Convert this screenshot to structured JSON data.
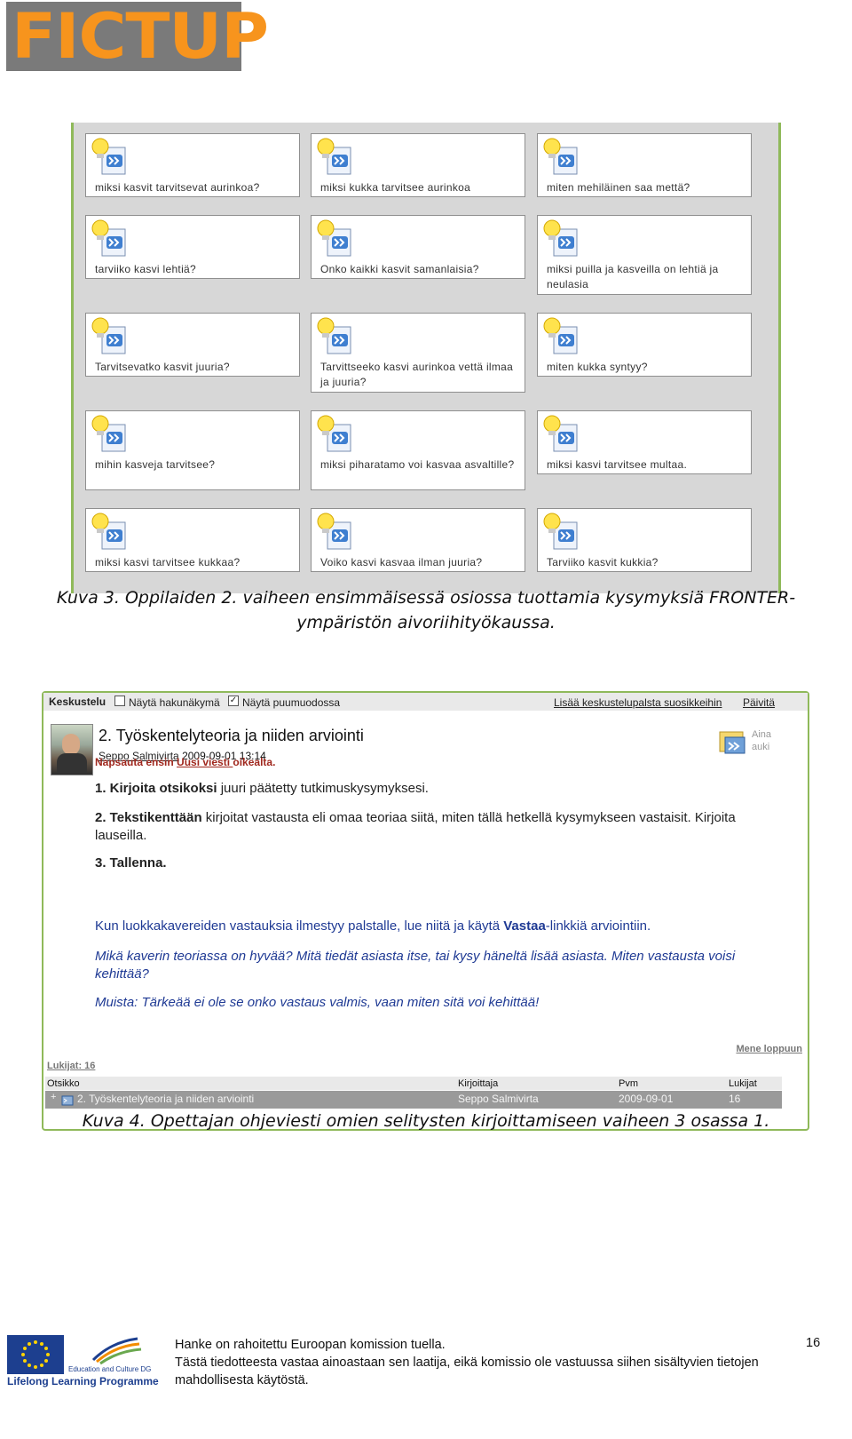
{
  "logo": {
    "text": "FICTUP",
    "bg": "#7a7a7a",
    "fg": "#f7941d"
  },
  "figure1": {
    "questions": [
      "miksi kasvit tarvitsevat aurinkoa?",
      "miksi kukka tarvitsee aurinkoa",
      "miten mehiläinen saa mettä?",
      "tarviiko kasvi lehtiä?",
      "Onko kaikki kasvit samanlaisia?",
      "miksi puilla ja kasveilla on lehtiä ja neulasia",
      "Tarvitsevatko kasvit juuria?",
      "Tarvittseeko kasvi aurinkoa vettä ilmaa ja juuria?",
      "miten kukka syntyy?",
      "mihin kasveja tarvitsee?",
      "miksi piharatamo voi kasvaa asvaltille?",
      "miksi kasvi tarvitsee multaa.",
      "miksi kasvi tarvitsee kukkaa?",
      "Voiko kasvi kasvaa ilman juuria?",
      "Tarviiko kasvit kukkia?"
    ],
    "caption_line1": "Kuva 3. Oppilaiden 2. vaiheen ensimmäisessä osiossa tuottamia kysymyksiä FRONTER-",
    "caption_line2": "ympäristön aivoriihityökaussa."
  },
  "figure2": {
    "topbar": {
      "title": "Keskustelu",
      "opt1": "Näytä hakunäkymä",
      "opt2": "Näytä puumuodossa",
      "link1": "Lisää keskustelupalsta suosikkeihin",
      "link2": "Päivitä"
    },
    "message": {
      "title": "2. Työskentelyteoria ja niiden arviointi",
      "author": "Seppo Salmivirta",
      "date": "2009-09-01 13:14",
      "aina": "Aina auki"
    },
    "instr_red_a": "Napsauta ensin ",
    "instr_red_link": "Uusi viesti ",
    "instr_red_b": "oikealta.",
    "step1_bold": "1. Kirjoita otsikoksi",
    "step1_rest": " juuri päätetty tutkimuskysymyksesi.",
    "step2_bold": "2. Tekstikenttään",
    "step2_rest": " kirjoitat vastausta eli omaa teoriaa siitä, miten tällä hetkellä kysymykseen vastaisit. Kirjoita lauseilla.",
    "step3": "3. Tallenna.",
    "blue1_a": "Kun luokkakavereiden vastauksia ilmestyy palstalle, lue niitä ja käytä ",
    "blue1_b": "Vastaa",
    "blue1_c": "-linkkiä arviointiin.",
    "blue2": "Mikä kaverin teoriassa on hyvää? Mitä tiedät asiasta itse, tai kysy häneltä lisää asiasta. Miten vastausta voisi kehittää?",
    "blue3": "Muista: Tärkeää ei ole se onko vastaus valmis, vaan miten sitä voi kehittää!",
    "mene": "Mene loppuun",
    "lukijat": "Lukijat: 16",
    "table": {
      "headers": [
        "Otsikko",
        "Kirjoittaja",
        "Pvm",
        "Lukijat"
      ],
      "row": [
        "2. Työskentelyteoria ja niiden arviointi",
        "Seppo Salmivirta",
        "2009-09-01",
        "16"
      ]
    },
    "caption": "Kuva 4. Opettajan ohjeviesti omien selitysten kirjoittamiseen vaiheen 3 osassa 1."
  },
  "footer": {
    "edu_label": "Education and Culture DG",
    "llp": "Lifelong Learning Programme",
    "line1": "Hanke on rahoitettu Euroopan komission tuella.",
    "line2": "Tästä tiedotteesta vastaa ainoastaan sen laatija, eikä komissio ole vastuussa siihen sisältyvien tietojen mahdollisesta käytöstä.",
    "page": "16"
  }
}
